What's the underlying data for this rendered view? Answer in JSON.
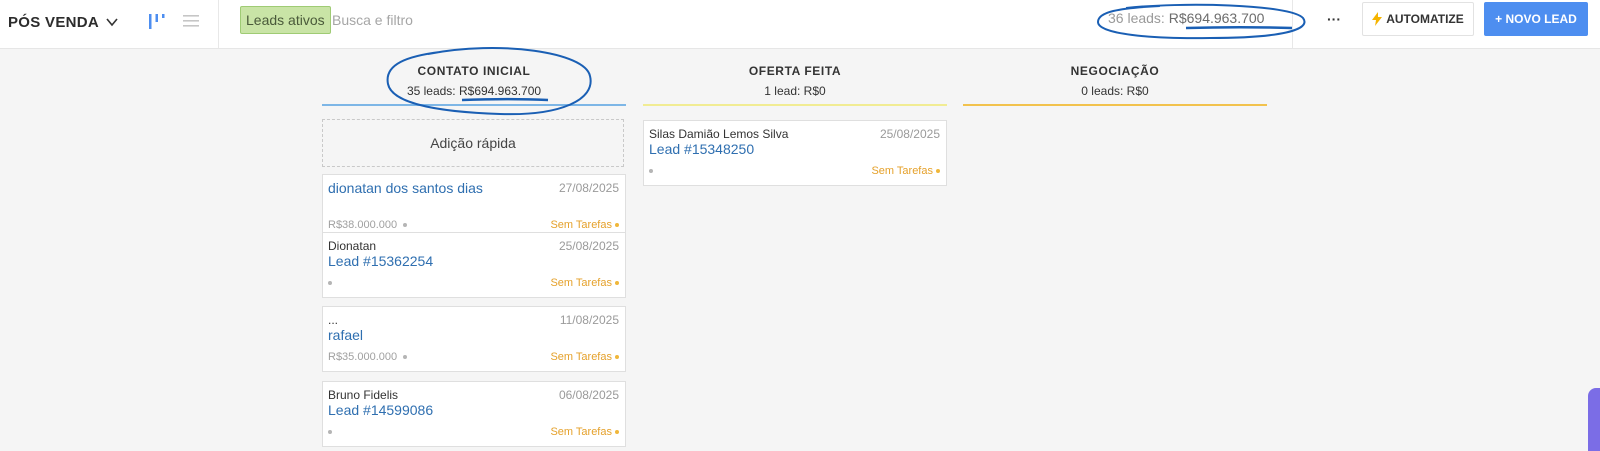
{
  "header": {
    "pipeline_name": "PÓS VENDA",
    "filter_chip": "Leads ativos",
    "search_placeholder": "Busca e filtro",
    "summary_count": "36 leads: ",
    "summary_amount": "R$694.963.700",
    "more_label": "···",
    "automatize_label": "AUTOMATIZE",
    "new_lead_label": "+ NOVO LEAD"
  },
  "columns": [
    {
      "name": "CONTATO INICIAL",
      "stats_prefix": "35 leads: ",
      "stats_amount": "R$694.963.700",
      "color": "#7db6e6"
    },
    {
      "name": "OFERTA FEITA",
      "stats_prefix": "1 lead: ",
      "stats_amount": "R$0",
      "color": "#f1ec93"
    },
    {
      "name": "NEGOCIAÇÃO",
      "stats_prefix": "0 leads: ",
      "stats_amount": "R$0",
      "color": "#f2c24d"
    }
  ],
  "quick_add_label": "Adição rápida",
  "cards": {
    "col1": [
      {
        "top_text": "",
        "date": "27/08/2025",
        "title": "dionatan dos santos dias",
        "price": "R$38.000.000",
        "tasks": "Sem Tarefas"
      },
      {
        "top_text": "Dionatan",
        "date": "25/08/2025",
        "title": "Lead #15362254",
        "price": "",
        "tasks": "Sem Tarefas"
      },
      {
        "top_text": "...",
        "date": "11/08/2025",
        "title": "rafael",
        "price": "R$35.000.000",
        "tasks": "Sem Tarefas"
      },
      {
        "top_text": "Bruno Fidelis",
        "date": "06/08/2025",
        "title": "Lead #14599086",
        "price": "",
        "tasks": "Sem Tarefas"
      }
    ],
    "col2": [
      {
        "top_text": "Silas Damião Lemos Silva",
        "date": "25/08/2025",
        "title": "Lead #15348250",
        "price": "",
        "tasks": "Sem Tarefas"
      }
    ]
  },
  "colors": {
    "accent_blue": "#4d8ef0",
    "chip_green": "#c9e4a6",
    "link_blue": "#2f6fb0",
    "task_yellow": "#e5a12b",
    "annotation_ink": "#1a5fb4"
  }
}
